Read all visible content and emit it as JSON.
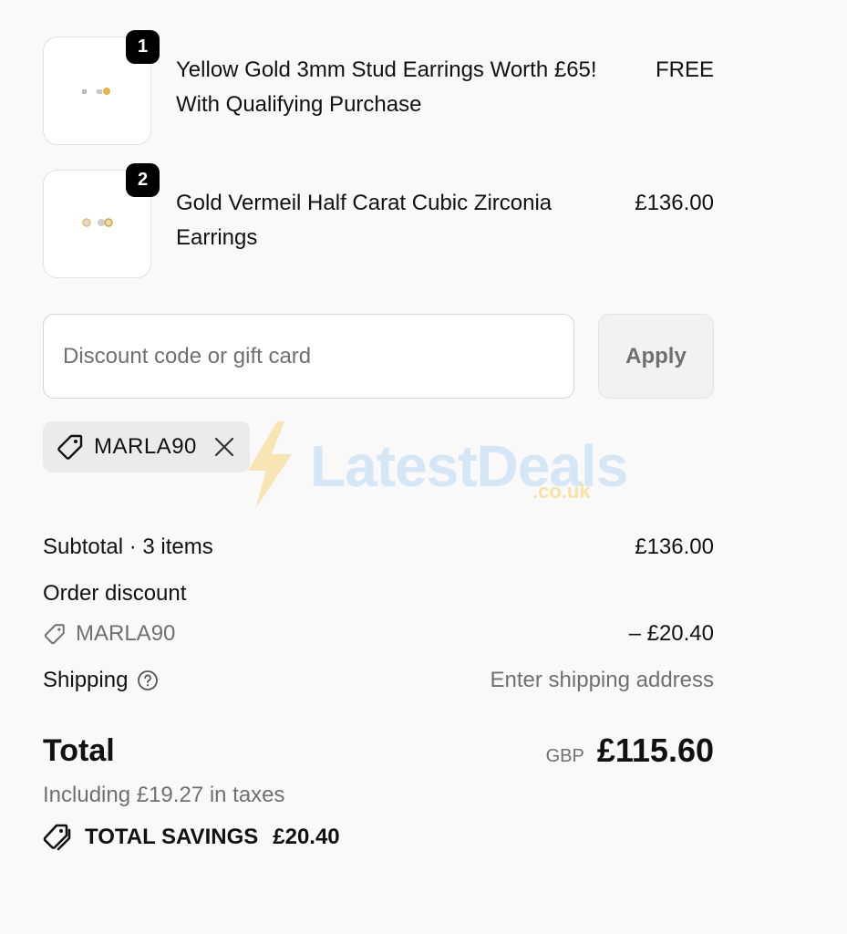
{
  "line_items": [
    {
      "quantity": "1",
      "title": "Yellow Gold 3mm Stud Earrings Worth £65! With Qualifying Purchase",
      "price": "FREE",
      "image_icon": "stud-earrings-image"
    },
    {
      "quantity": "2",
      "title": "Gold Vermeil Half Carat Cubic Zirconia Earrings",
      "price": "£136.00",
      "image_icon": "cz-earrings-image"
    }
  ],
  "discount": {
    "placeholder": "Discount code or gift card",
    "value": "",
    "apply_label": "Apply",
    "applied_code": "MARLA90"
  },
  "watermark": {
    "text": "LatestDeals",
    "sub": ".co.uk"
  },
  "summary": {
    "subtotal_label": "Subtotal · 3 items",
    "subtotal_value": "£136.00",
    "order_discount_label": "Order discount",
    "discount_code": "MARLA90",
    "discount_value": "– £20.40",
    "shipping_label": "Shipping",
    "shipping_value": "Enter shipping address",
    "total_label": "Total",
    "currency": "GBP",
    "total_value": "£115.60",
    "taxes_text": "Including £19.27 in taxes",
    "savings_label": "TOTAL SAVINGS",
    "savings_value": "£20.40"
  },
  "colors": {
    "background": "#f9f9f9",
    "text": "#111111",
    "muted": "#707070",
    "badge": "#000000",
    "watermark_blue": "#cfe4f6",
    "watermark_yellow": "#f7e3a8"
  }
}
